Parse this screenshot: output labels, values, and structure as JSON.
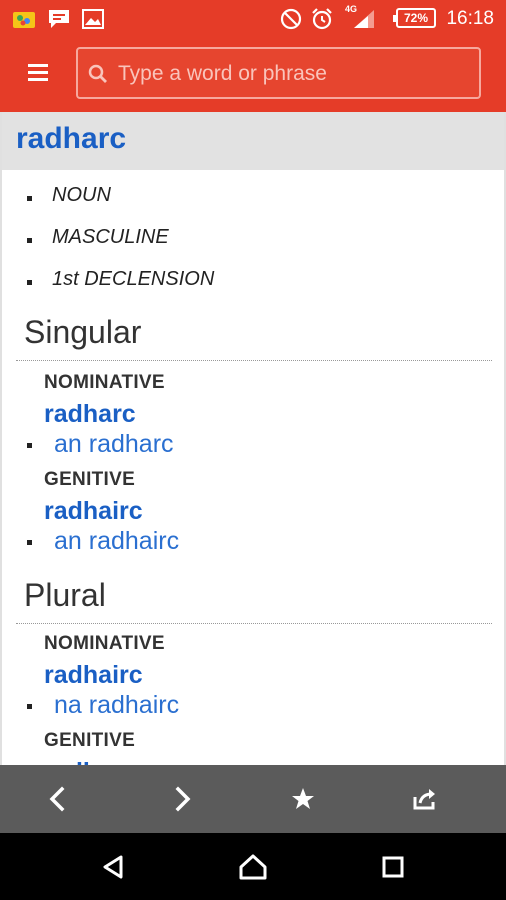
{
  "status_bar": {
    "time": "16:18",
    "battery": "72%",
    "network": "4G",
    "icons": [
      "photos-icon",
      "message-icon",
      "image-icon",
      "do-not-disturb-icon",
      "alarm-icon",
      "signal-icon",
      "battery-icon"
    ]
  },
  "app_bar": {
    "menu_icon": "menu-icon",
    "search_placeholder": "Type a word or phrase",
    "search_value": ""
  },
  "entry": {
    "headword": "radharc",
    "grammar": [
      "NOUN",
      "MASCULINE",
      "1st DECLENSION"
    ],
    "sections": [
      {
        "title": "Singular",
        "cases": [
          {
            "label": "NOMINATIVE",
            "form": "radharc",
            "example": "an radharc"
          },
          {
            "label": "GENITIVE",
            "form": "radhairc",
            "example": "an radhairc"
          }
        ]
      },
      {
        "title": "Plural",
        "cases": [
          {
            "label": "NOMINATIVE",
            "form": "radhairc",
            "example": "na radhairc"
          },
          {
            "label": "GENITIVE",
            "form": "radharc",
            "example": ""
          }
        ]
      }
    ]
  },
  "toolbar": {
    "buttons": [
      "back-icon",
      "forward-icon",
      "star-icon",
      "share-icon"
    ]
  },
  "nav_bar": {
    "buttons": [
      "nav-back-icon",
      "nav-home-icon",
      "nav-recents-icon"
    ]
  },
  "colors": {
    "accent": "#e53c28",
    "link": "#1a5fc4",
    "toolbar": "#5b5b5b"
  }
}
